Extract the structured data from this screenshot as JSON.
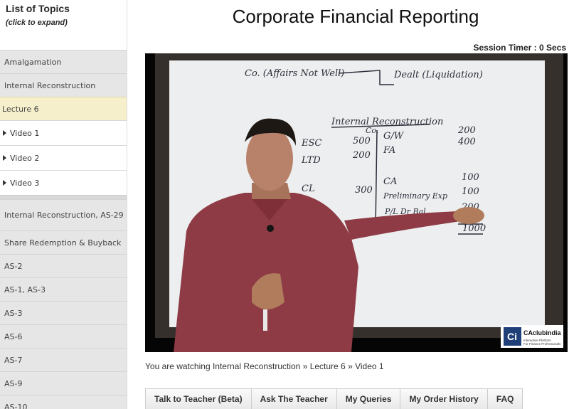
{
  "sidebar": {
    "title": "List of Topics",
    "subtitle": "(click to expand)",
    "topics_top": [
      "Amalgamation",
      "Internal Reconstruction"
    ],
    "active_lecture": "Lecture 6",
    "videos": [
      "Video 1",
      "Video 2",
      "Video 3"
    ],
    "topics_bottom": [
      "Internal Reconstruction, AS-29",
      "Share Redemption & Buyback",
      "AS-2",
      "AS-1, AS-3",
      "AS-3",
      "AS-6",
      "AS-7",
      "AS-9",
      "AS-10"
    ]
  },
  "page": {
    "title": "Corporate Financial Reporting",
    "session_timer": "Session Timer : 0 Secs"
  },
  "video": {
    "board_top_left": "Co. (Affairs Not Well)",
    "board_top_right": "Dealt (Liquidation)",
    "board_heading": "Internal Reconstruction",
    "board_sub": "Co.",
    "left_rows": [
      {
        "label": "ESC",
        "value": "500"
      },
      {
        "label": "LTD",
        "value": "200"
      },
      {
        "label": "CL",
        "value": "300"
      }
    ],
    "right_rows": [
      {
        "label": "G/W",
        "value": "200"
      },
      {
        "label": "FA",
        "value": "400"
      },
      {
        "label": "CA",
        "value": "100"
      },
      {
        "label": "Preliminary Exp",
        "value": "100"
      },
      {
        "label": "P/L Dr Bal",
        "value": "200"
      }
    ],
    "board_total": "1000",
    "logo_name": "CAclubindia",
    "logo_tag1": "Interactive Platform",
    "logo_tag2": "For Finance Professionals",
    "colors": {
      "board": "#eceeef",
      "wall": "#35302b",
      "shirt": "#8e3b45",
      "ink": "#2d2d3a"
    }
  },
  "breadcrumb": {
    "prefix": "You are watching",
    "text": "You are watching Internal Reconstruction » Lecture 6 » Video 1"
  },
  "tabs": [
    "Talk to Teacher (Beta)",
    "Ask The Teacher",
    "My Queries",
    "My Order History",
    "FAQ"
  ]
}
